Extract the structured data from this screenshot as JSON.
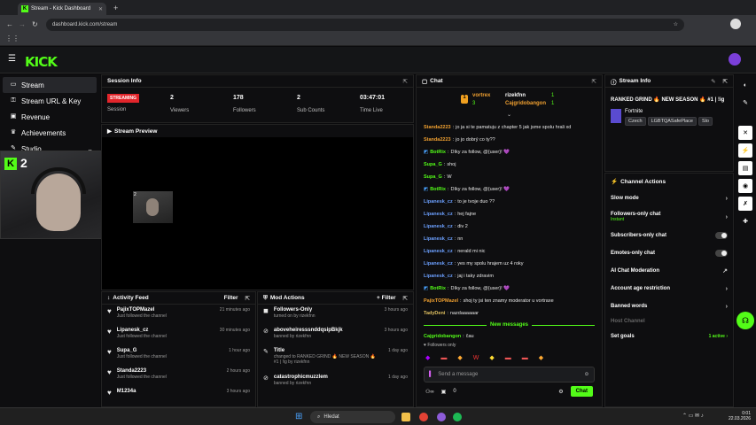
{
  "browser": {
    "tab_title": "Stream - Kick Dashboard",
    "tab_close": "✕",
    "new_tab": "+",
    "url": "dashboard.kick.com/stream"
  },
  "brand": {
    "logo": "KICK",
    "accent": "#53fc18"
  },
  "sidebar": {
    "items": [
      {
        "label": "Stream",
        "icon": "broadcast-icon"
      },
      {
        "label": "Stream URL & Key",
        "icon": "key-icon"
      },
      {
        "label": "Revenue",
        "icon": "money-icon"
      },
      {
        "label": "Achievements",
        "icon": "trophy-icon"
      },
      {
        "label": "Studio",
        "icon": "studio-icon"
      }
    ]
  },
  "overlay": {
    "badge": "2"
  },
  "session": {
    "title": "Session Info",
    "status": "STREAMING",
    "status_label": "Session",
    "stats": [
      {
        "value": "2",
        "label": "Viewers"
      },
      {
        "value": "178",
        "label": "Followers"
      },
      {
        "value": "2",
        "label": "Sub Counts"
      },
      {
        "value": "03:47:01",
        "label": "Time Live"
      }
    ]
  },
  "preview": {
    "title": "Stream Preview",
    "pip_badge": "2"
  },
  "activity": {
    "title": "Activity Feed",
    "filter": "Filter",
    "rows": [
      {
        "name": "PajixTOPMazel",
        "sub": "Just followed the channel",
        "time": "21 minutes ago"
      },
      {
        "name": "Lipanesk_cz",
        "sub": "Just followed the channel",
        "time": "30 minutes ago"
      },
      {
        "name": "Supa_G",
        "sub": "Just followed the channel",
        "time": "1 hour ago"
      },
      {
        "name": "Standa2223",
        "sub": "Just followed the channel",
        "time": "2 hours ago"
      },
      {
        "name": "M1234a",
        "sub": "",
        "time": "3 hours ago"
      }
    ]
  },
  "mod": {
    "title": "Mod Actions",
    "filter": "Filter",
    "rows": [
      {
        "name": "Followers-Only",
        "sub": "turned on by rizekfnn",
        "time": "3 hours ago"
      },
      {
        "name": "aboveheiresssnddqsipBkjk",
        "sub": "banned by rizekfnn",
        "time": "3 hours ago"
      },
      {
        "name": "Title",
        "sub": "changed to RANKED GRIND 🔥 NEW SEASON 🔥 #1 | !ig by rizekfnn",
        "time": "1 day ago"
      },
      {
        "name": "catastrophicmuzzlem",
        "sub": "banned by rizekfnn",
        "time": "1 day ago"
      },
      {
        "name": "",
        "sub": "",
        "time": ""
      }
    ]
  },
  "chat": {
    "title": "Chat",
    "leaders": [
      {
        "rank": "1",
        "name": "vortrex",
        "count": "3"
      },
      {
        "name": "rizekfnn",
        "count": "1"
      },
      {
        "name": "Cajgridobangon",
        "count": "1"
      }
    ],
    "lines": [
      {
        "user": "Standa2223",
        "color": "#f0a030",
        "text": "jo ja si te pamatuju z chapter 5 jak jsme spolu hrali xd"
      },
      {
        "user": "Standa2223",
        "color": "#f0a030",
        "text": "jo jo dobrý co ty??"
      },
      {
        "user": "BotRix",
        "color": "#53fc18",
        "text": "Díky za follow, @{user}! 💜"
      },
      {
        "user": "Supa_G",
        "color": "#53fc18",
        "text": "shoj"
      },
      {
        "user": "Supa_G",
        "color": "#53fc18",
        "text": "W"
      },
      {
        "user": "BotRix",
        "color": "#53fc18",
        "text": "Díky za follow, @{user}! 💜"
      },
      {
        "user": "Lipanesk_cz",
        "color": "#6ca0ff",
        "text": "to je tvoje duo ??"
      },
      {
        "user": "Lipanesk_cz",
        "color": "#6ca0ff",
        "text": "hej fajne"
      },
      {
        "user": "Lipanesk_cz",
        "color": "#6ca0ff",
        "text": "div 2"
      },
      {
        "user": "Lipanesk_cz",
        "color": "#6ca0ff",
        "text": "nn"
      },
      {
        "user": "Lipanesk_cz",
        "color": "#6ca0ff",
        "text": "nerald mi nic"
      },
      {
        "user": "Lipanesk_cz",
        "color": "#6ca0ff",
        "text": "yes my spolu hrajem uz 4 roky"
      },
      {
        "user": "Lipanesk_cz",
        "color": "#6ca0ff",
        "text": "jaj i taky zdravim"
      },
      {
        "user": "BotRix",
        "color": "#53fc18",
        "text": "Díky za follow, @{user}! 💜"
      },
      {
        "user": "PajixTOPMazel",
        "color": "#f0a030",
        "text": "shoj ty jsi ten znamy moderator u vortraxe"
      },
      {
        "user": "TadyDeni",
        "color": "#e0c060",
        "text": "nazdaaaaaar"
      }
    ],
    "new_messages": "New messages",
    "last": {
      "user": "Cajgridobangon",
      "text": "čau"
    },
    "followers_only": "Followers only",
    "placeholder": "Send a message",
    "count": "0",
    "send": "Chat"
  },
  "streaminfo": {
    "title": "Stream Info",
    "stream_title": "RANKED GRIND 🔥 NEW SEASON 🔥 #1 | !ig",
    "category": "Fortnite",
    "tags": [
      "Czech",
      "LGBTQASafePlace",
      "Slo"
    ]
  },
  "actions": {
    "title": "Channel Actions",
    "rows": [
      {
        "label": "Slow mode",
        "sub": "",
        "right": "›"
      },
      {
        "label": "Followers-only chat",
        "sub": "Instant",
        "right": "›"
      },
      {
        "label": "Subscribers-only chat",
        "sub": "",
        "right": "toggle"
      },
      {
        "label": "Emotes-only chat",
        "sub": "",
        "right": "toggle"
      },
      {
        "label": "AI Chat Moderation",
        "sub": "",
        "right": "↗"
      },
      {
        "label": "Account age restriction",
        "sub": "",
        "right": "›"
      },
      {
        "label": "Banned words",
        "sub": "",
        "right": "›"
      },
      {
        "label": "Host Channel",
        "sub": "",
        "right": ""
      },
      {
        "label": "Set goals",
        "sub": "",
        "right": "1 active ›"
      }
    ]
  },
  "taskbar": {
    "search": "Hledat",
    "time": "0:01",
    "date": "22.03.2026"
  }
}
